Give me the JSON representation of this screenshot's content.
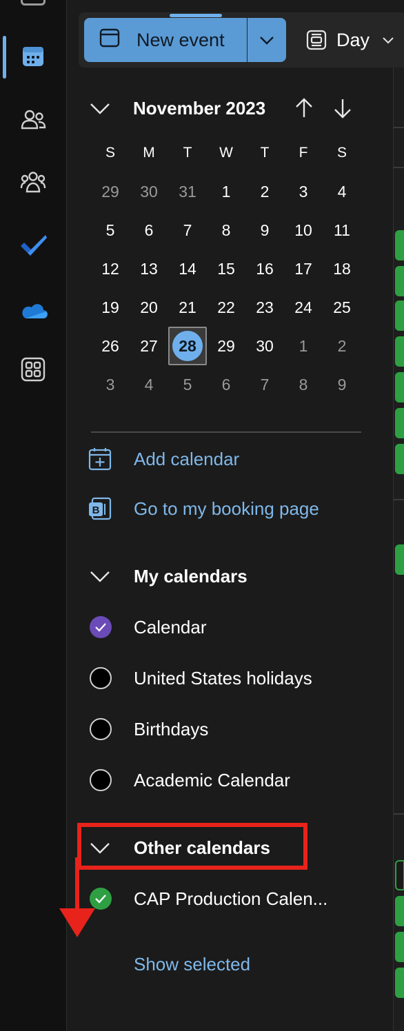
{
  "toolbar": {
    "new_event_label": "New event",
    "view_label": "Day"
  },
  "mini_calendar": {
    "title": "November 2023",
    "weekdays": [
      "S",
      "M",
      "T",
      "W",
      "T",
      "F",
      "S"
    ],
    "weeks": [
      [
        "29",
        "30",
        "31",
        "1",
        "2",
        "3",
        "4"
      ],
      [
        "5",
        "6",
        "7",
        "8",
        "9",
        "10",
        "11"
      ],
      [
        "12",
        "13",
        "14",
        "15",
        "16",
        "17",
        "18"
      ],
      [
        "19",
        "20",
        "21",
        "22",
        "23",
        "24",
        "25"
      ],
      [
        "26",
        "27",
        "28",
        "29",
        "30",
        "1",
        "2"
      ],
      [
        "3",
        "4",
        "5",
        "6",
        "7",
        "8",
        "9"
      ]
    ],
    "today": "28"
  },
  "links": {
    "add_calendar": "Add calendar",
    "booking_page": "Go to my booking page"
  },
  "my_calendars": {
    "heading": "My calendars",
    "items": [
      {
        "label": "Calendar",
        "checked": true,
        "color": "#6b4bb8"
      },
      {
        "label": "United States holidays",
        "checked": false
      },
      {
        "label": "Birthdays",
        "checked": false
      },
      {
        "label": "Academic Calendar",
        "checked": false
      }
    ]
  },
  "other_calendars": {
    "heading": "Other calendars",
    "items": [
      {
        "label": "CAP Production Calen...",
        "checked": true,
        "color": "#2ea043"
      }
    ],
    "show_selected": "Show selected"
  },
  "colors": {
    "accent": "#6fb0ec",
    "button": "#5b9bd5",
    "annotation": "#e8231b"
  }
}
